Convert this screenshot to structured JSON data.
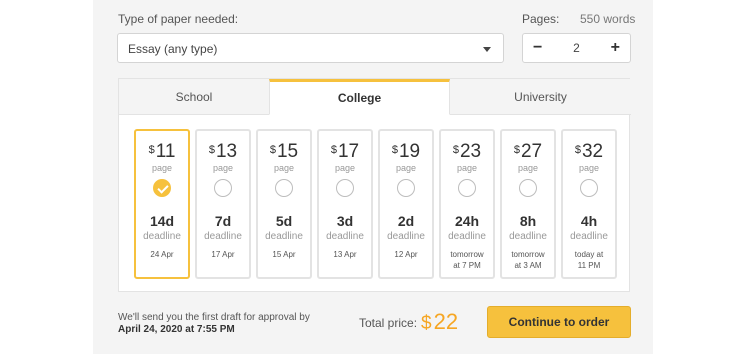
{
  "form": {
    "type_label": "Type of paper needed:",
    "type_value": "Essay (any type)",
    "pages_label": "Pages:",
    "words_count": "550 words",
    "pages_value": "2",
    "minus_label": "−",
    "plus_label": "+"
  },
  "tabs": [
    {
      "label": "School"
    },
    {
      "label": "College"
    },
    {
      "label": "University"
    }
  ],
  "cards": [
    {
      "dollar": "$",
      "price": "11",
      "per": "page",
      "deadline": "14d",
      "deadline_label": "deadline",
      "date": "24 Apr",
      "selected": true
    },
    {
      "dollar": "$",
      "price": "13",
      "per": "page",
      "deadline": "7d",
      "deadline_label": "deadline",
      "date": "17 Apr",
      "selected": false
    },
    {
      "dollar": "$",
      "price": "15",
      "per": "page",
      "deadline": "5d",
      "deadline_label": "deadline",
      "date": "15 Apr",
      "selected": false
    },
    {
      "dollar": "$",
      "price": "17",
      "per": "page",
      "deadline": "3d",
      "deadline_label": "deadline",
      "date": "13 Apr",
      "selected": false
    },
    {
      "dollar": "$",
      "price": "19",
      "per": "page",
      "deadline": "2d",
      "deadline_label": "deadline",
      "date": "12 Apr",
      "selected": false
    },
    {
      "dollar": "$",
      "price": "23",
      "per": "page",
      "deadline": "24h",
      "deadline_label": "deadline",
      "date_line1": "tomorrow",
      "date_line2": "at 7 PM",
      "selected": false
    },
    {
      "dollar": "$",
      "price": "27",
      "per": "page",
      "deadline": "8h",
      "deadline_label": "deadline",
      "date_line1": "tomorrow",
      "date_line2": "at 3 AM",
      "selected": false
    },
    {
      "dollar": "$",
      "price": "32",
      "per": "page",
      "deadline": "4h",
      "deadline_label": "deadline",
      "date_line1": "today at",
      "date_line2": "11 PM",
      "selected": false
    }
  ],
  "footer": {
    "note_line1": "We'll send you the first draft for approval by",
    "note_line2": "April 24, 2020 at 7:55 PM",
    "total_label": "Total price:",
    "total_currency": "$",
    "total_value": "22",
    "cta_label": "Continue to order"
  },
  "colors": {
    "accent": "#f6c13d",
    "price": "#f6a623"
  }
}
